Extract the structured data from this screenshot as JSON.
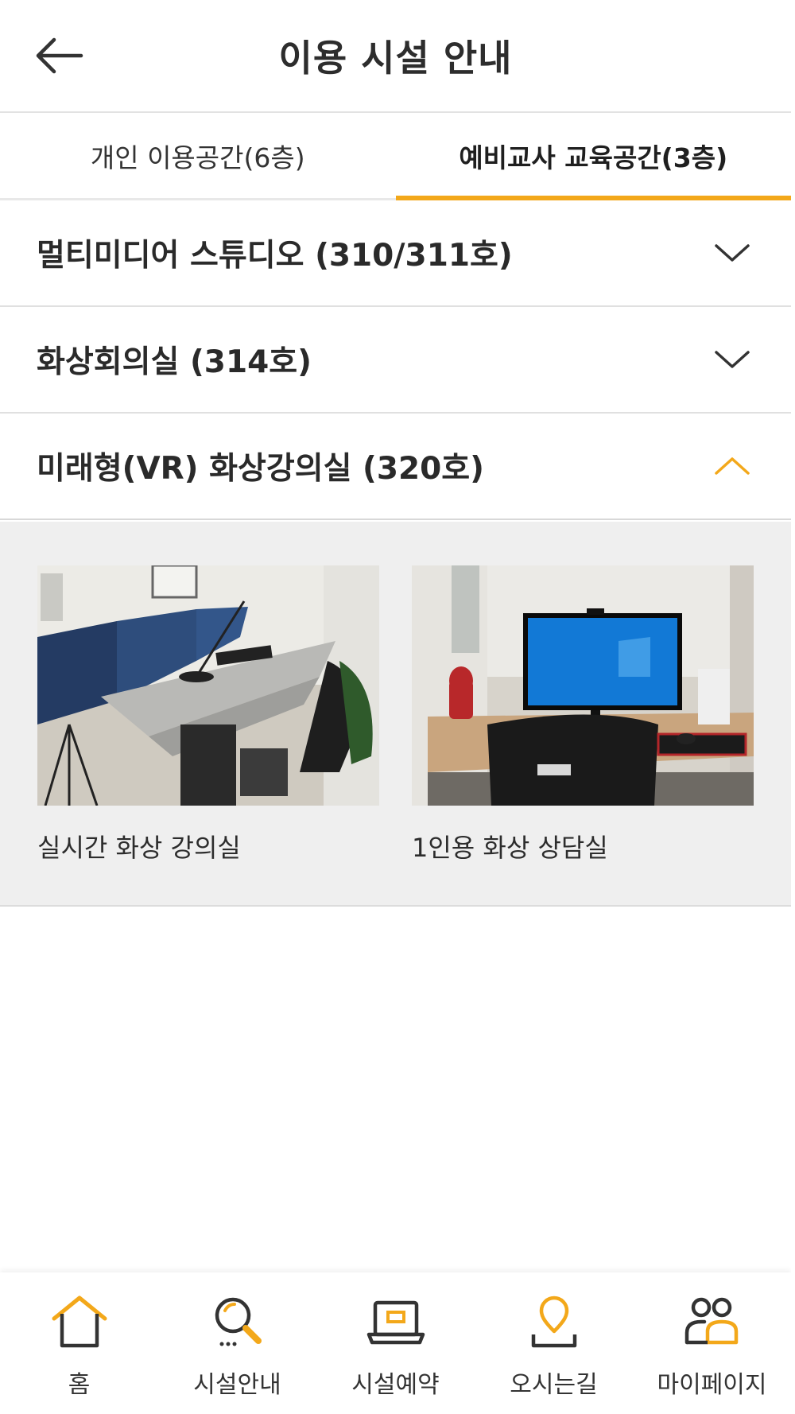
{
  "header": {
    "title": "이용 시설 안내",
    "back_icon": "arrow-left-icon"
  },
  "tabs": [
    {
      "label": "개인 이용공간(6층)",
      "active": false
    },
    {
      "label": "예비교사 교육공간(3층)",
      "active": true
    }
  ],
  "accordion": [
    {
      "title": "멀티미디어 스튜디오 (310/311호)",
      "expanded": false,
      "icon": "chevron-down-icon"
    },
    {
      "title": "화상회의실 (314호)",
      "expanded": false,
      "icon": "chevron-down-icon"
    },
    {
      "title": "미래형(VR) 화상강의실 (320호)",
      "expanded": true,
      "icon": "chevron-up-icon"
    }
  ],
  "panel": {
    "cards": [
      {
        "label": "실시간 화상 강의실",
        "image": "lecture-room-photo"
      },
      {
        "label": "1인용 화상 상담실",
        "image": "consultation-room-photo"
      }
    ]
  },
  "bottom_nav": [
    {
      "label": "홈",
      "icon": "home-icon"
    },
    {
      "label": "시설안내",
      "icon": "search-icon"
    },
    {
      "label": "시설예약",
      "icon": "laptop-icon"
    },
    {
      "label": "오시는길",
      "icon": "location-pin-icon"
    },
    {
      "label": "마이페이지",
      "icon": "users-icon"
    }
  ],
  "colors": {
    "accent": "#f3a81a",
    "text": "#2b2b2b",
    "panel_bg": "#efefef",
    "divider": "#e0e0e0"
  }
}
